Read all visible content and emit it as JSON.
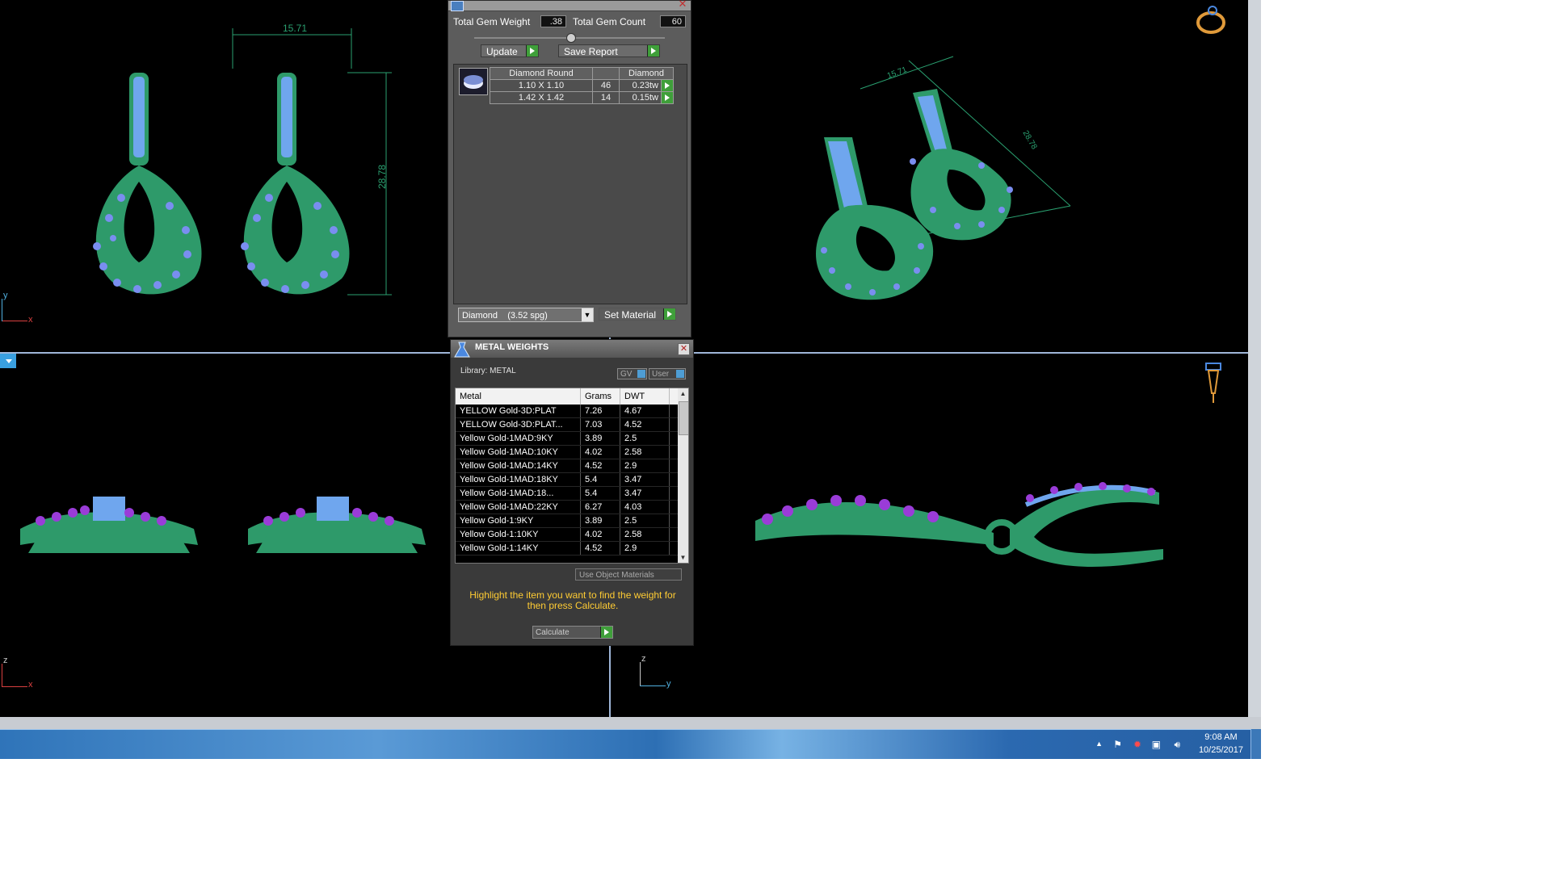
{
  "gem_panel": {
    "total_weight_label": "Total Gem Weight",
    "total_weight_value": ".38",
    "total_count_label": "Total Gem Count",
    "total_count_value": "60",
    "update_label": "Update",
    "save_report_label": "Save Report",
    "table": {
      "headers": [
        "Diamond Round",
        "",
        "Diamond"
      ],
      "rows": [
        {
          "size": "1.10 X 1.10",
          "count": "46",
          "weight": "0.23tw"
        },
        {
          "size": "1.42 X 1.42",
          "count": "14",
          "weight": "0.15tw"
        }
      ]
    },
    "material_select_value": "Diamond    (3.52 spg)",
    "set_material_label": "Set Material"
  },
  "metal_panel": {
    "title": "METAL WEIGHTS",
    "library_label": "Library: METAL",
    "toggle_gv": "GV",
    "toggle_user": "User",
    "columns": [
      "Metal",
      "Grams",
      "DWT"
    ],
    "rows": [
      {
        "metal": "YELLOW Gold-3D:PLAT",
        "grams": "7.26",
        "dwt": "4.67"
      },
      {
        "metal": "YELLOW Gold-3D:PLAT...",
        "grams": "7.03",
        "dwt": "4.52"
      },
      {
        "metal": "Yellow Gold-1MAD:9KY",
        "grams": "3.89",
        "dwt": "2.5"
      },
      {
        "metal": "Yellow Gold-1MAD:10KY",
        "grams": "4.02",
        "dwt": "2.58"
      },
      {
        "metal": "Yellow Gold-1MAD:14KY",
        "grams": "4.52",
        "dwt": "2.9"
      },
      {
        "metal": "Yellow Gold-1MAD:18KY",
        "grams": "5.4",
        "dwt": "3.47"
      },
      {
        "metal": "Yellow Gold-1MAD:18...",
        "grams": "5.4",
        "dwt": "3.47"
      },
      {
        "metal": "Yellow Gold-1MAD:22KY",
        "grams": "6.27",
        "dwt": "4.03"
      },
      {
        "metal": "Yellow Gold-1:9KY",
        "grams": "3.89",
        "dwt": "2.5"
      },
      {
        "metal": "Yellow Gold-1:10KY",
        "grams": "4.02",
        "dwt": "2.58"
      },
      {
        "metal": "Yellow Gold-1:14KY",
        "grams": "4.52",
        "dwt": "2.9"
      }
    ],
    "use_object_materials": "Use Object Materials",
    "hint": "Highlight the item you want to find the weight for then press Calculate.",
    "calculate_label": "Calculate"
  },
  "viewports": {
    "front": {
      "width_dim": "15.71",
      "height_dim": "28.78",
      "axis_h": "x",
      "axis_v": "y"
    },
    "perspective": {
      "dim_a": "15.71",
      "dim_b": "28.78"
    },
    "side_left": {
      "axis_h": "x",
      "axis_v": "z"
    },
    "side_right": {
      "axis_h": "y",
      "axis_v": "z"
    }
  },
  "taskbar": {
    "time": "9:08 AM",
    "date": "10/25/2017"
  },
  "colors": {
    "metal_green": "#2e9a6a",
    "gem_blue": "#5b8fe8",
    "gem_purple": "#9a3cd8",
    "dimension_green": "#2aa070",
    "hint_yellow": "#ffcc33"
  }
}
